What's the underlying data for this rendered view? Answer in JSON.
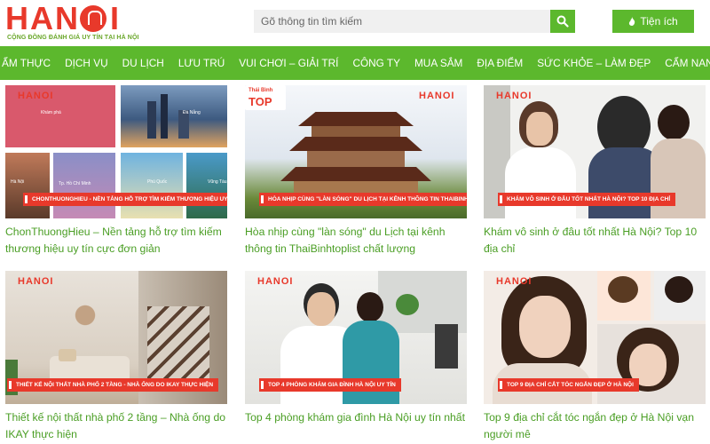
{
  "brand": {
    "logo_text": "HAN",
    "logo_text_end": "I",
    "tagline": "CỘNG ĐỒNG ĐÁNH GIÁ UY TÍN TẠI HÀ NỘI"
  },
  "search": {
    "placeholder": "Gõ thông tin tìm kiếm"
  },
  "utility": {
    "label": "Tiện ích"
  },
  "nav": {
    "items": [
      "ẨM THỰC",
      "DỊCH VỤ",
      "DU LỊCH",
      "LƯU TRÚ",
      "VUI CHƠI – GIẢI TRÍ",
      "CÔNG TY",
      "MUA SẮM",
      "ĐỊA ĐIỂM",
      "SỨC KHỎE – LÀM ĐẸP",
      "CẨM NANG"
    ]
  },
  "articles": [
    {
      "title": "ChonThuongHieu – Nền tảng hỗ trợ tìm kiếm thương hiệu uy tín cực đơn giản",
      "badge": "CHONTHUONGHIEU - NỀN TẢNG HỖ TRỢ TÌM KIẾM THƯƠNG HIỆU UY TÍN",
      "thumb_labels": [
        "Khám phá",
        "Đà Nẵng",
        "Hà Nội",
        "Tp. Hồ Chí Minh",
        "Phú Quốc",
        "Vũng Tàu"
      ]
    },
    {
      "title": "Hòa nhịp cùng \"làn sóng\" du Lịch tại kênh thông tin ThaiBinhtoplist chất lượng",
      "badge": "HÒA NHỊP CÙNG \"LÀN SÓNG\" DU LỊCH TẠI KÊNH THÔNG TIN THAIBINHTOPLIST",
      "thumb_labels": [
        "Thái Bình",
        "TOP"
      ]
    },
    {
      "title": "Khám vô sinh ở đâu tốt nhất Hà Nội? Top 10 địa chỉ",
      "badge": "KHÁM VÔ SINH Ở ĐÂU TỐT NHẤT HÀ NỘI? TOP 10 ĐỊA CHỈ",
      "thumb_labels": []
    },
    {
      "title": "Thiết kế nội thất nhà phố 2 tầng – Nhà ống do IKAY thực hiện",
      "badge": "THIẾT KẾ NỘI THẤT NHÀ PHỐ 2 TẦNG - NHÀ ỐNG DO IKAY THỰC HIỆN",
      "thumb_labels": []
    },
    {
      "title": "Top 4 phòng khám gia đình Hà Nội uy tín nhất",
      "badge": "TOP 4 PHÒNG KHÁM GIA ĐÌNH HÀ NỘI UY TÍN",
      "thumb_labels": []
    },
    {
      "title": "Top 9 địa chỉ cắt tóc ngắn đẹp ở Hà Nội vạn người mê",
      "badge": "TOP 9 ĐỊA CHỈ CẮT TÓC NGẮN ĐẸP Ở HÀ NỘI",
      "thumb_labels": []
    }
  ],
  "colors": {
    "brand_red": "#e8392b",
    "brand_green": "#5cb82d",
    "link_green": "#4a9e24"
  }
}
